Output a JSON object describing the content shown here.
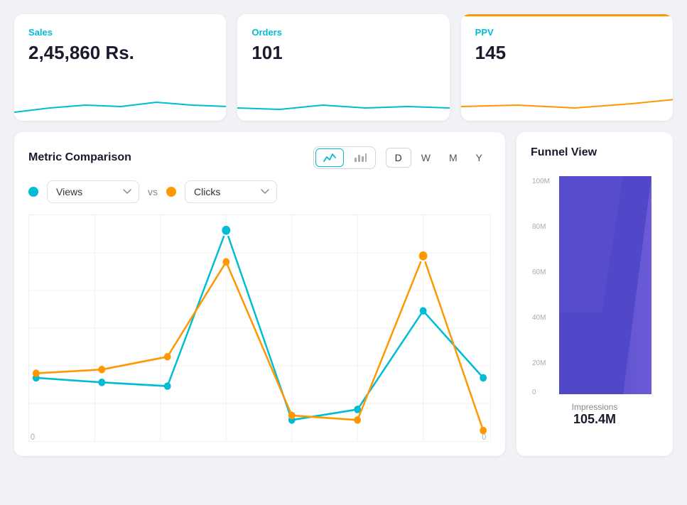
{
  "cards": [
    {
      "id": "sales",
      "label": "Sales",
      "value": "2,45,860 Rs.",
      "color": "#00bcd4"
    },
    {
      "id": "orders",
      "label": "Orders",
      "value": "101",
      "color": "#00bcd4"
    },
    {
      "id": "ppv",
      "label": "PPV",
      "value": "145",
      "color": "#00bcd4",
      "partial": true
    }
  ],
  "metric_comparison": {
    "title": "Metric Comparison",
    "metric1": "Views",
    "metric2": "Clicks",
    "vs_label": "vs",
    "time_buttons": [
      "D",
      "W",
      "M",
      "Y"
    ],
    "active_time": "D",
    "chart_types": [
      "line",
      "bar"
    ],
    "active_chart": "line"
  },
  "funnel": {
    "title": "Funnel View",
    "label": "Impressions",
    "value": "105.4M",
    "y_labels": [
      "100M",
      "80M",
      "60M",
      "40M",
      "20M",
      "0"
    ]
  },
  "chart_data": {
    "views": [
      30,
      28,
      26,
      100,
      10,
      15,
      62,
      30
    ],
    "clicks": [
      32,
      34,
      40,
      85,
      12,
      10,
      88,
      5
    ],
    "x_labels": [
      "0",
      "",
      "",
      "",
      "",
      "",
      "",
      "0"
    ],
    "y_label_left": "0",
    "y_label_right": "0"
  }
}
